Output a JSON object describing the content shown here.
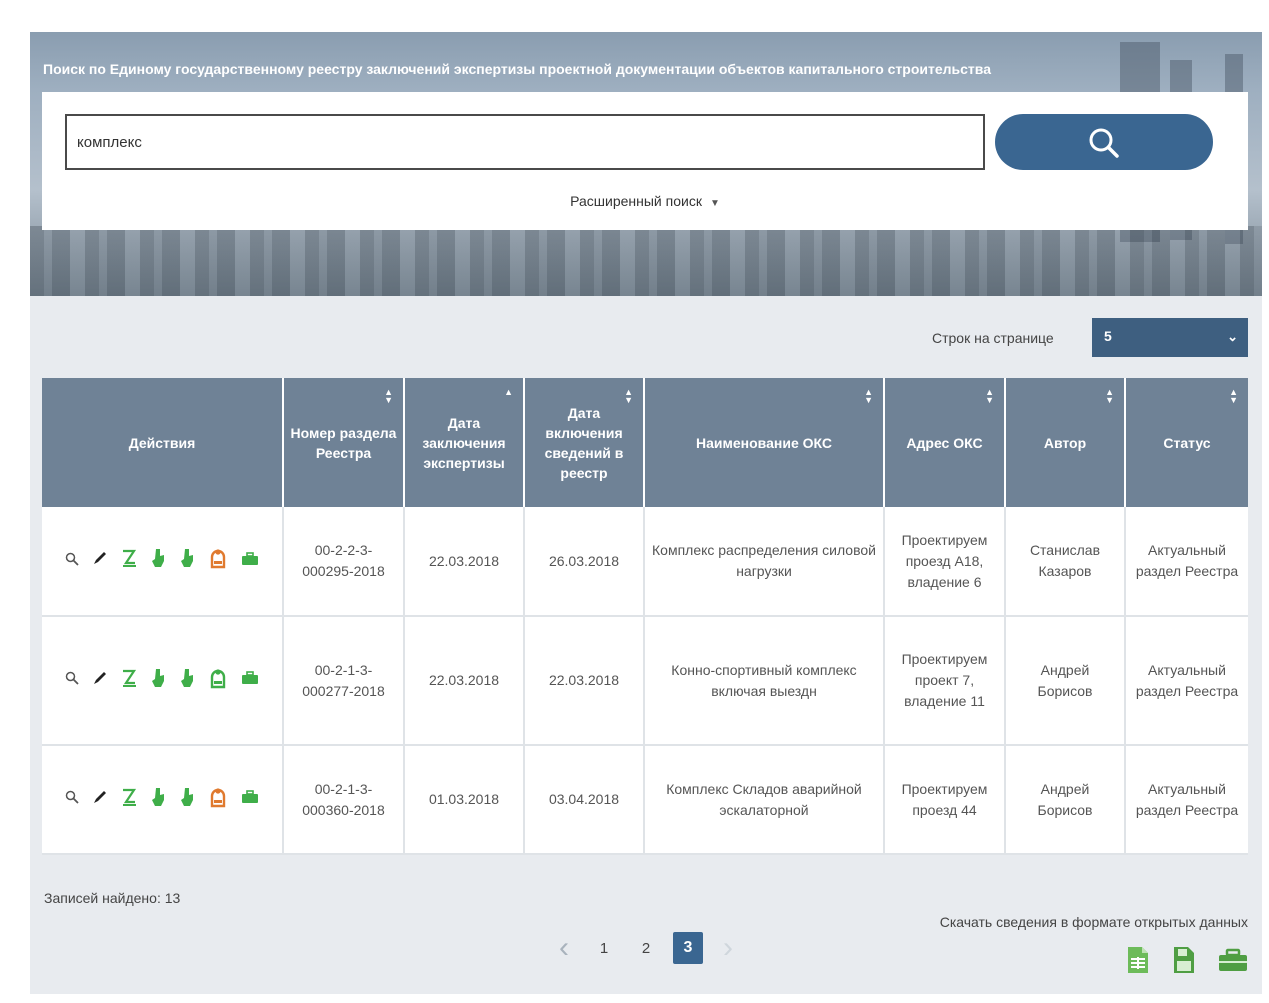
{
  "hero": {
    "title": "Поиск по Единому государственному реестру заключений экспертизы проектной документации объектов капитального строительства"
  },
  "search": {
    "value": "комплекс",
    "advanced_label": "Расширенный поиск"
  },
  "rows_per_page": {
    "label": "Строк на странице",
    "value": "5"
  },
  "table": {
    "headers": [
      "Действия",
      "Номер раздела Реестра",
      "Дата заключения экспертизы",
      "Дата включения сведений в реестр",
      "Наименование ОКС",
      "Адрес ОКС",
      "Автор",
      "Статус"
    ],
    "rows": [
      {
        "number": "00-2-2-3-000295-2018",
        "conclusion_date": "22.03.2018",
        "inclusion_date": "26.03.2018",
        "name": "Комплекс распределения силовой нагрузки",
        "address": "Проектируем проезд А18, владение 6",
        "author": "Станислав Казаров",
        "status": "Актуальный раздел Реестра",
        "badge_color": "#e07a2f"
      },
      {
        "number": "00-2-1-3-000277-2018",
        "conclusion_date": "22.03.2018",
        "inclusion_date": "22.03.2018",
        "name": "Конно-спортивный комплекс включая выездн",
        "address": "Проектируем проект 7, владение 11",
        "author": "Андрей Борисов",
        "status": "Актуальный раздел Реестра",
        "badge_color": "#3fae49"
      },
      {
        "number": "00-2-1-3-000360-2018",
        "conclusion_date": "01.03.2018",
        "inclusion_date": "03.04.2018",
        "name": "Комплекс Складов аварийной эскалаторной",
        "address": "Проектируем проезд 44",
        "author": "Андрей Борисов",
        "status": "Актуальный раздел Реестра",
        "badge_color": "#e07a2f"
      }
    ]
  },
  "records_found": "Записей найдено: 13",
  "pagination": {
    "pages": [
      "1",
      "2",
      "3"
    ],
    "current": "3"
  },
  "download": {
    "label": "Скачать сведения в формате открытых данных",
    "icons": [
      "csv-file-icon",
      "save-file-icon",
      "archive-icon"
    ]
  },
  "colors": {
    "accent": "#3a6691",
    "header": "#6f8296",
    "green": "#3fae49",
    "orange": "#e07a2f"
  }
}
